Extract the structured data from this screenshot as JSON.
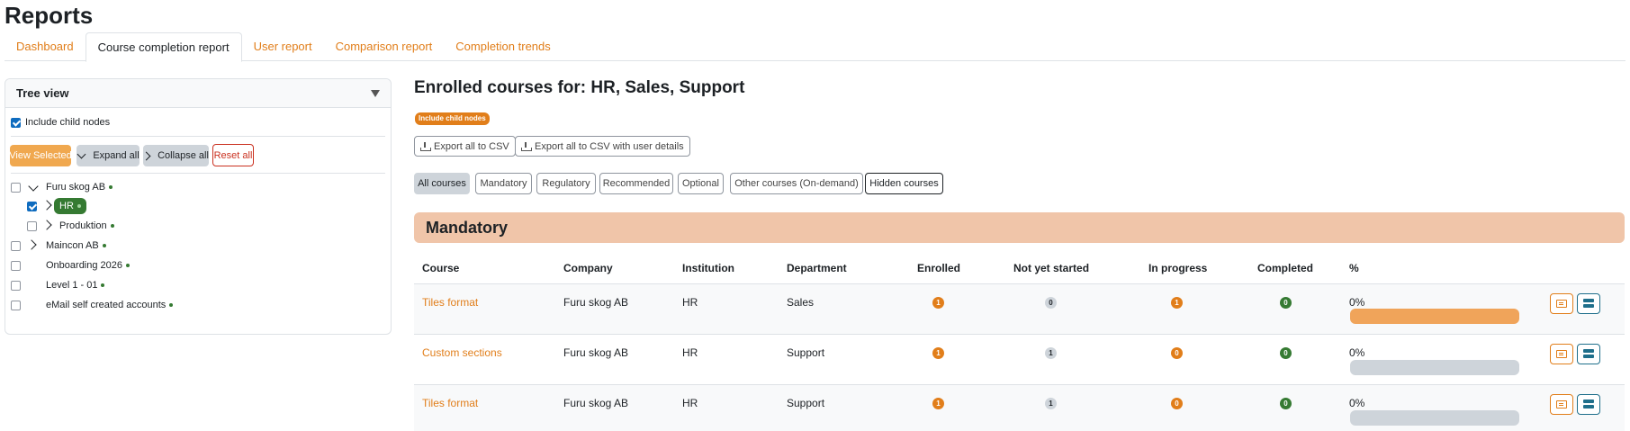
{
  "page": {
    "title": "Reports"
  },
  "tabs": [
    {
      "label": "Dashboard",
      "active": false
    },
    {
      "label": "Course completion report",
      "active": true
    },
    {
      "label": "User report",
      "active": false
    },
    {
      "label": "Comparison report",
      "active": false
    },
    {
      "label": "Completion trends",
      "active": false
    }
  ],
  "tree": {
    "title": "Tree view",
    "include_child_nodes": {
      "label": "Include child nodes",
      "checked": true
    },
    "buttons": {
      "view_selected": "View Selected",
      "expand_all": "Expand all",
      "collapse_all": "Collapse all",
      "reset_all": "Reset all"
    },
    "nodes": [
      {
        "label": "Furu skog AB",
        "checked": false,
        "expanded": true
      },
      {
        "label": "HR",
        "checked": true,
        "expanded": false,
        "selected": true
      },
      {
        "label": "Produktion",
        "checked": false,
        "expanded": false
      },
      {
        "label": "Maincon AB",
        "checked": false,
        "expanded": false
      },
      {
        "label": "Onboarding 2026",
        "checked": false
      },
      {
        "label": "Level 1 - 01",
        "checked": false
      },
      {
        "label": "eMail self created accounts",
        "checked": false
      }
    ]
  },
  "main": {
    "title": "Enrolled courses for: HR, Sales, Support",
    "badge": "Include child nodes",
    "export": {
      "csv": "Export all to CSV",
      "csv_users": "Export all to CSV with user details"
    },
    "filters": [
      "All courses",
      "Mandatory",
      "Regulatory",
      "Recommended",
      "Optional",
      "Other courses (On-demand)",
      "Hidden courses"
    ],
    "section_title": "Mandatory",
    "columns": [
      "Course",
      "Company",
      "Institution",
      "Department",
      "Enrolled",
      "Not yet started",
      "In progress",
      "Completed",
      "%"
    ],
    "rows": [
      {
        "course": "Tiles format",
        "company": "Furu skog AB",
        "institution": "HR",
        "department": "Sales",
        "enrolled": "1",
        "not_started": "0",
        "in_progress": "1",
        "completed": "0",
        "percent_label": "0%",
        "progress": 0
      },
      {
        "course": "Custom sections",
        "company": "Furu skog AB",
        "institution": "HR",
        "department": "Support",
        "enrolled": "1",
        "not_started": "1",
        "in_progress": "0",
        "completed": "0",
        "percent_label": "0%",
        "progress": 0
      },
      {
        "course": "Tiles format",
        "company": "Furu skog AB",
        "institution": "HR",
        "department": "Support",
        "enrolled": "1",
        "not_started": "1",
        "in_progress": "0",
        "completed": "0",
        "percent_label": "0%",
        "progress": 0
      }
    ]
  },
  "colors": {
    "accent": "#e17e1a",
    "success": "#357a32",
    "section": "#f0c5a9",
    "progress_bar_first": "#f0a45a"
  }
}
